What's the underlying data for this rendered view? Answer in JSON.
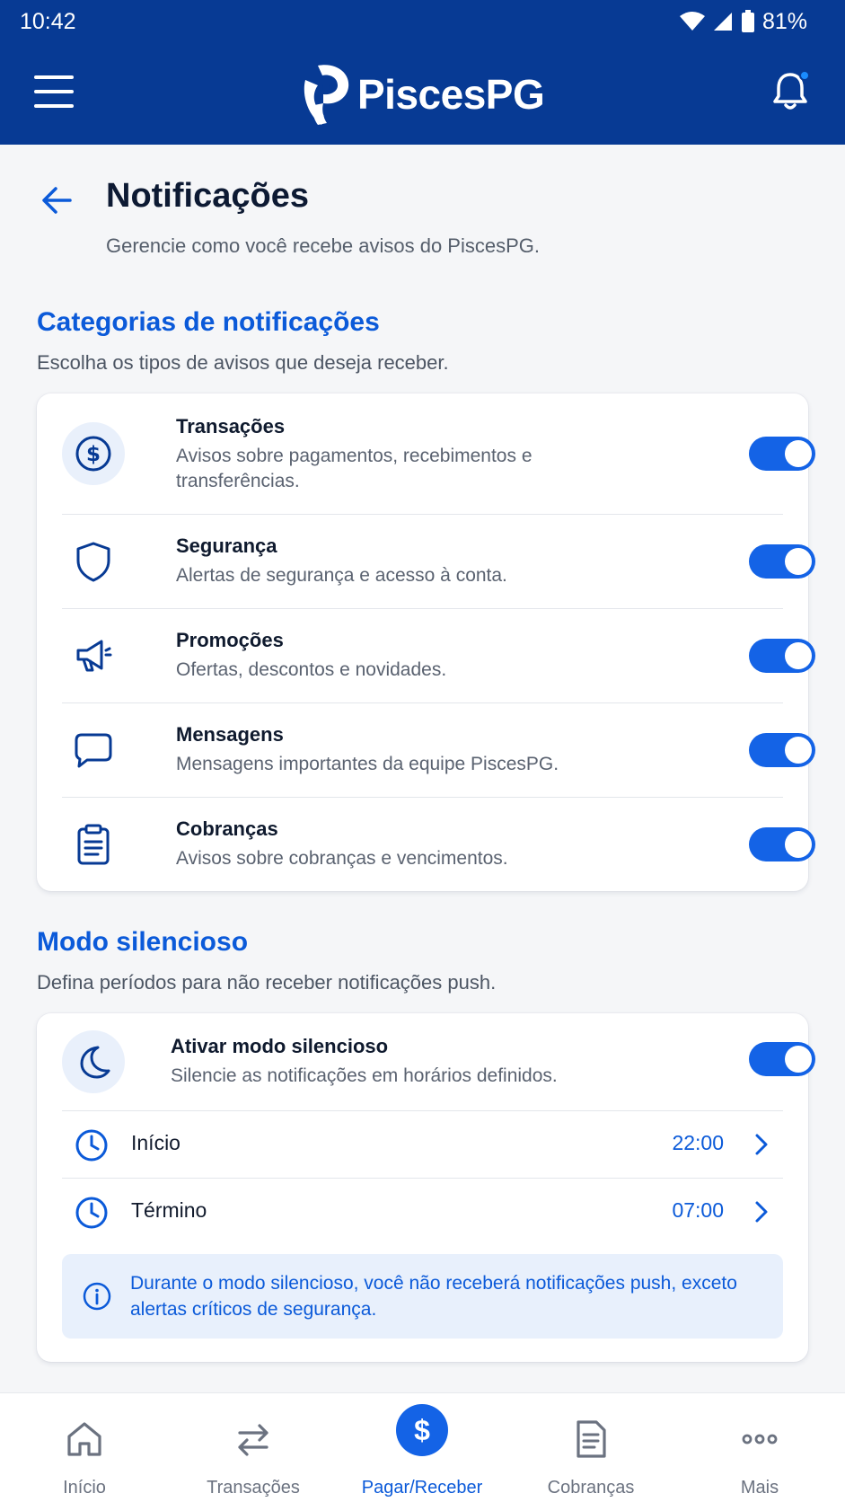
{
  "status": {
    "time": "10:42",
    "battery": "81%"
  },
  "app": {
    "name": "PiscesPG"
  },
  "page": {
    "title": "Notificações",
    "subtitle": "Gerencie como você recebe avisos do PiscesPG."
  },
  "categories": {
    "title": "Categorias de notificações",
    "subtitle": "Escolha os tipos de avisos que deseja receber.",
    "items": [
      {
        "icon": "dollar-circle-icon",
        "title": "Transações",
        "desc": "Avisos sobre pagamentos, recebimentos e transferências.",
        "enabled": true
      },
      {
        "icon": "shield-icon",
        "title": "Segurança",
        "desc": "Alertas de segurança e acesso à conta.",
        "enabled": true
      },
      {
        "icon": "megaphone-icon",
        "title": "Promoções",
        "desc": "Ofertas, descontos e novidades.",
        "enabled": true
      },
      {
        "icon": "message-icon",
        "title": "Mensagens",
        "desc": "Mensagens importantes da equipe PiscesPG.",
        "enabled": true
      },
      {
        "icon": "clipboard-icon",
        "title": "Cobranças",
        "desc": "Avisos sobre cobranças e vencimentos.",
        "enabled": true
      }
    ]
  },
  "silent": {
    "title": "Modo silencioso",
    "subtitle": "Defina períodos para não receber notificações push.",
    "toggle_title": "Ativar modo silencioso",
    "toggle_desc": "Silencie as notificações em horários definidos.",
    "enabled": true,
    "start_label": "Início",
    "start_value": "22:00",
    "end_label": "Término",
    "end_value": "07:00",
    "info": "Durante o modo silencioso, você não receberá notificações push, exceto alertas críticos de segurança."
  },
  "nav": {
    "items": [
      {
        "label": "Início",
        "icon": "home-icon"
      },
      {
        "label": "Transações",
        "icon": "swap-arrows-icon"
      },
      {
        "label": "Pagar/Receber",
        "icon": "dollar-icon",
        "active": true
      },
      {
        "label": "Cobranças",
        "icon": "document-icon"
      },
      {
        "label": "Mais",
        "icon": "more-dots-icon"
      }
    ]
  },
  "colors": {
    "primary": "#073a94",
    "accent": "#1463e6",
    "link": "#0b5ad9",
    "background": "#f5f6f8"
  }
}
